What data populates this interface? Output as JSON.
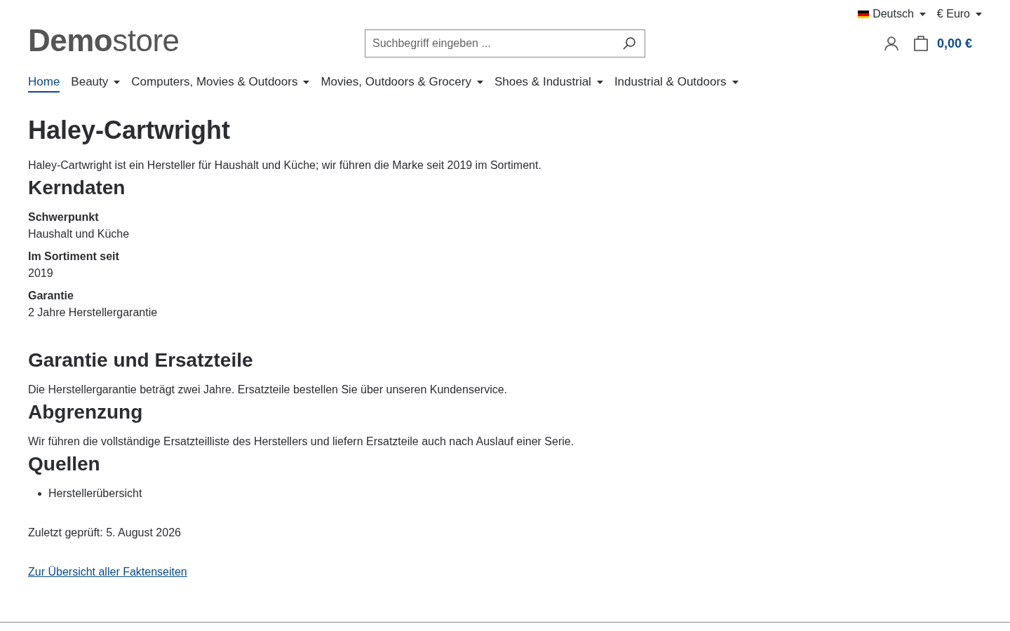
{
  "topbar": {
    "language": {
      "label": "Deutsch"
    },
    "currency": {
      "label": "€ Euro"
    }
  },
  "header": {
    "logo": "**Demo**store",
    "search": {
      "placeholder": "Suchbegriff eingeben ..."
    },
    "cart": {
      "total": "0,00 €"
    }
  },
  "nav": [
    {
      "label": "Home",
      "selected": true,
      "dropdown": false
    },
    {
      "label": "Beauty",
      "selected": false,
      "dropdown": true
    },
    {
      "label": "Computers, Movies & Outdoors",
      "selected": false,
      "dropdown": true
    },
    {
      "label": "Movies, Outdoors & Grocery",
      "selected": false,
      "dropdown": true
    },
    {
      "label": "Shoes & Industrial",
      "selected": false,
      "dropdown": true
    },
    {
      "label": "Industrial & Outdoors",
      "selected": false,
      "dropdown": true
    }
  ],
  "content": {
    "title": "Haley-Cartwright",
    "blocks": [
      {
        "kind": "paragraph",
        "text": "Haley-Cartwright ist ein Hersteller für Haushalt und Küche; wir führen die Marke seit 2019 im Sortiment."
      },
      {
        "kind": "heading",
        "text": "Kerndaten"
      },
      {
        "kind": "facts",
        "items": [
          {
            "term": "Schwerpunkt",
            "value": "Haushalt und Küche"
          },
          {
            "term": "Im Sortiment seit",
            "value": "2019"
          },
          {
            "term": "Garantie",
            "value": "2 Jahre Herstellergarantie"
          }
        ]
      },
      {
        "kind": "heading",
        "text": "Garantie und Ersatzteile"
      },
      {
        "kind": "paragraph",
        "text": "Die Herstellergarantie beträgt zwei Jahre. Ersatzteile bestellen Sie über unseren Kundenservice."
      },
      {
        "kind": "heading",
        "text": "Abgrenzung"
      },
      {
        "kind": "paragraph",
        "text": "Wir führen die vollständige Ersatzteilliste des Herstellers und liefern Ersatzteile auch nach Auslauf einer Serie."
      },
      {
        "kind": "heading",
        "text": "Quellen"
      },
      {
        "kind": "list",
        "items": [
          "Herstellerübersicht"
        ]
      },
      {
        "kind": "note",
        "text": "Zuletzt geprüft: 5. August 2026"
      },
      {
        "kind": "link",
        "text": "Zur Übersicht aller Faktenseiten"
      }
    ]
  }
}
